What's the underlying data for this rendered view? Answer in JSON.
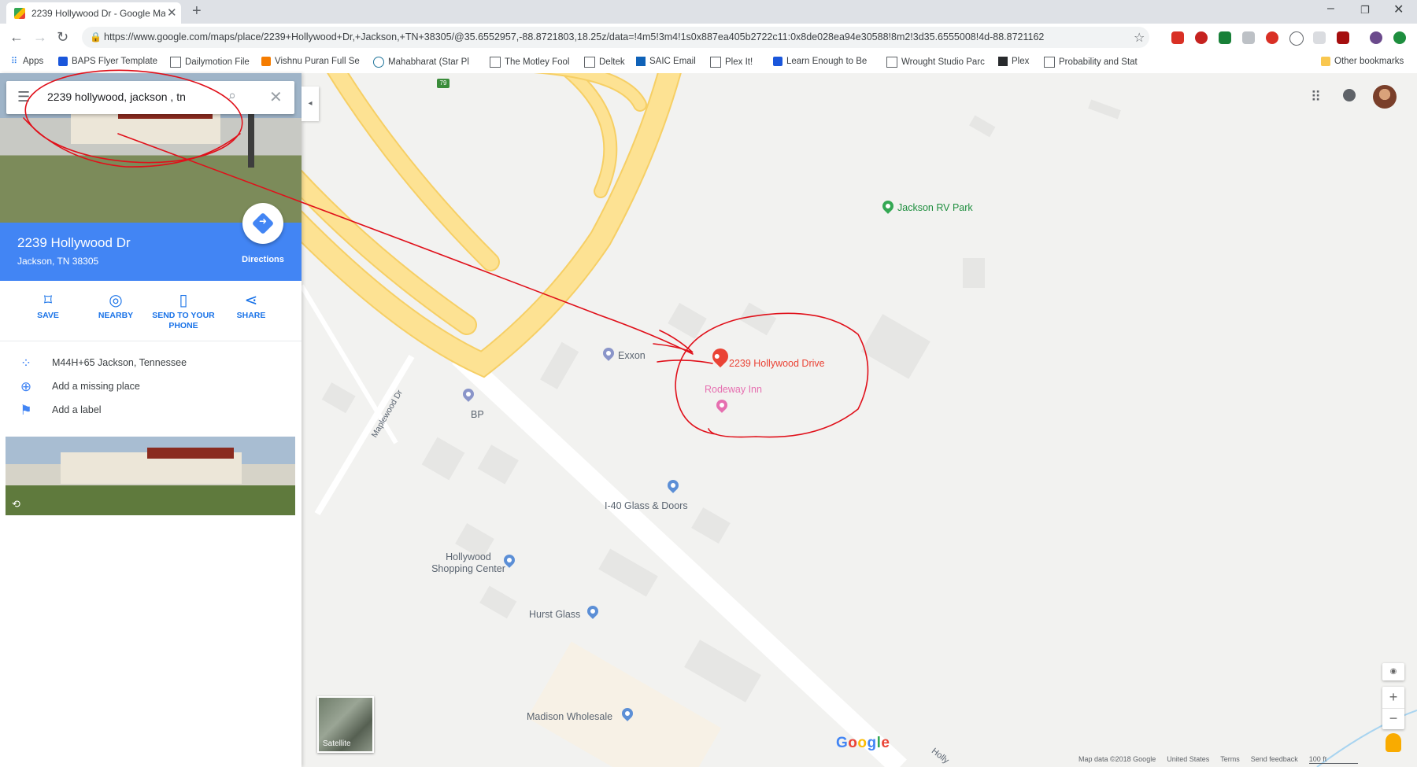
{
  "browser": {
    "tab_title": "2239 Hollywood Dr - Google Ma",
    "url": "https://www.google.com/maps/place/2239+Hollywood+Dr,+Jackson,+TN+38305/@35.6552957,-88.8721803,18.25z/data=!4m5!3m4!1s0x887ea405b2722c11:0x8de028ea94e30588!8m2!3d35.6555008!4d-88.8721162",
    "bookmarks": [
      {
        "label": "Apps",
        "icon": "apps-icon"
      },
      {
        "label": "BAPS Flyer Template",
        "icon": "site-icon"
      },
      {
        "label": "Dailymotion File",
        "icon": "page-icon"
      },
      {
        "label": "Vishnu Puran Full Se",
        "icon": "blogger-icon"
      },
      {
        "label": "Mahabharat (Star Pl",
        "icon": "wordpress-icon"
      },
      {
        "label": "The Motley Fool",
        "icon": "page-icon"
      },
      {
        "label": "Deltek",
        "icon": "page-icon"
      },
      {
        "label": "SAIC Email",
        "icon": "outlook-icon"
      },
      {
        "label": "Plex It!",
        "icon": "page-icon"
      },
      {
        "label": "Learn Enough to Be",
        "icon": "site-icon"
      },
      {
        "label": "Wrought Studio Parc",
        "icon": "page-icon"
      },
      {
        "label": "Plex",
        "icon": "plex-icon"
      },
      {
        "label": "Probability and Stat",
        "icon": "page-icon"
      }
    ],
    "other_bookmarks": "Other bookmarks"
  },
  "panel": {
    "search_value": "2239 hollywood, jackson , tn",
    "place_name": "2239 Hollywood Dr",
    "place_address": "Jackson, TN 38305",
    "directions_label": "Directions",
    "actions": [
      {
        "label": "SAVE",
        "icon": "bookmark-icon"
      },
      {
        "label": "NEARBY",
        "icon": "nearby-icon"
      },
      {
        "label": "SEND TO YOUR PHONE",
        "icon": "phone-icon"
      },
      {
        "label": "SHARE",
        "icon": "share-icon"
      }
    ],
    "info": [
      {
        "text": "M44H+65 Jackson, Tennessee",
        "icon": "plus-code-icon"
      },
      {
        "text": "Add a missing place",
        "icon": "add-place-icon"
      },
      {
        "text": "Add a label",
        "icon": "flag-icon"
      }
    ]
  },
  "map": {
    "road_shield": "79",
    "places": [
      {
        "name": "Jackson RV Park",
        "kind": "park"
      },
      {
        "name": "Exxon",
        "kind": "gas"
      },
      {
        "name": "BP",
        "kind": "gas"
      },
      {
        "name": "2239 Hollywood Drive",
        "kind": "selected"
      },
      {
        "name": "Rodeway Inn",
        "kind": "hotel"
      },
      {
        "name": "I-40 Glass & Doors",
        "kind": "business"
      },
      {
        "name": "Hollywood Shopping Center",
        "kind": "shopping"
      },
      {
        "name": "Hurst Glass",
        "kind": "business"
      },
      {
        "name": "Madison Wholesale",
        "kind": "business"
      }
    ],
    "street_labels": [
      "Maplewood Dr",
      "Holly"
    ],
    "satellite_label": "Satellite",
    "logo": "Google",
    "footer": [
      "Map data ©2018 Google",
      "United States",
      "Terms",
      "Send feedback",
      "100 ft"
    ]
  },
  "colors": {
    "accent_blue": "#4285f4",
    "road_yellow": "#fde293",
    "road_yellow_edge": "#f6cf65",
    "selected_red": "#ea4335",
    "hotel_pink": "#e66fb0",
    "park_green": "#34a853",
    "annotation_red": "#e0101a"
  }
}
